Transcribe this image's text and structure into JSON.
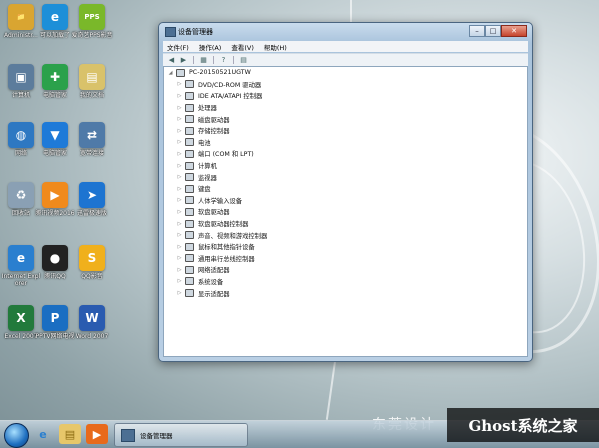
{
  "desktop": {
    "icons": [
      {
        "label": "Administr...",
        "icon": "user-folder-icon",
        "color": "#d9a531",
        "glyph": "📁"
      },
      {
        "label": "可以加载了",
        "icon": "browser-icon",
        "color": "#1d8fd8",
        "glyph": "e"
      },
      {
        "label": "爱奇艺PPS影音",
        "icon": "pps-icon",
        "color": "#7ab82a",
        "glyph": "PPS"
      },
      {
        "label": "计算机",
        "icon": "computer-icon",
        "color": "#5c7c9c",
        "glyph": "▣"
      },
      {
        "label": "电脑管家",
        "icon": "shield-icon",
        "color": "#2ba14b",
        "glyph": "✚"
      },
      {
        "label": "我的文档",
        "icon": "documents-icon",
        "color": "#d9c26a",
        "glyph": "▤"
      },
      {
        "label": "网络",
        "icon": "network-icon",
        "color": "#2e78c2",
        "glyph": "◍"
      },
      {
        "label": "电脑管家",
        "icon": "security-icon",
        "color": "#1e7ad8",
        "glyph": "▼"
      },
      {
        "label": "宽带连接",
        "icon": "broadband-icon",
        "color": "#4f7aa8",
        "glyph": "⇄"
      },
      {
        "label": "回收站",
        "icon": "recycle-bin-icon",
        "color": "#8aa0b4",
        "glyph": "♻"
      },
      {
        "label": "腾讯视频2016",
        "icon": "video-icon",
        "color": "#f08a1c",
        "glyph": "▶"
      },
      {
        "label": "迅雷极速版",
        "icon": "thunder-icon",
        "color": "#1d74d1",
        "glyph": "➤"
      },
      {
        "label": "Internet Explorer",
        "icon": "ie-icon",
        "color": "#2a7fcf",
        "glyph": "e"
      },
      {
        "label": "腾讯QQ",
        "icon": "qq-icon",
        "color": "#222222",
        "glyph": "●"
      },
      {
        "label": "QQ影音",
        "icon": "qq-player-icon",
        "color": "#f0b01c",
        "glyph": "S"
      },
      {
        "label": "Excel 2007",
        "icon": "excel-icon",
        "color": "#227a3c",
        "glyph": "X"
      },
      {
        "label": "PPTV网络电视",
        "icon": "pptv-icon",
        "color": "#1a6ec2",
        "glyph": "P"
      },
      {
        "label": "Word 2007",
        "icon": "word-icon",
        "color": "#2a5bb0",
        "glyph": "W"
      }
    ]
  },
  "window": {
    "title": "设备管理器",
    "buttons": {
      "minimize": "–",
      "maximize": "□",
      "close": "✕"
    },
    "menu": [
      "文件(F)",
      "操作(A)",
      "查看(V)",
      "帮助(H)"
    ],
    "toolbar": [
      "◀",
      "▶",
      "▦",
      "?",
      "▤"
    ],
    "tree": {
      "root": "PC-20150521UGTW",
      "items": [
        "DVD/CD-ROM 驱动器",
        "IDE ATA/ATAPI 控制器",
        "处理器",
        "磁盘驱动器",
        "存储控制器",
        "电池",
        "端口 (COM 和 LPT)",
        "计算机",
        "监视器",
        "键盘",
        "人体学输入设备",
        "软盘驱动器",
        "软盘驱动器控制器",
        "声音、视频和游戏控制器",
        "鼠标和其他指针设备",
        "通用串行总线控制器",
        "网络适配器",
        "系统设备",
        "显示适配器"
      ]
    }
  },
  "taskbar": {
    "task_label": "设备管理器"
  },
  "wallpaper_text": "东莞设计",
  "watermark": "Ghost系统之家"
}
